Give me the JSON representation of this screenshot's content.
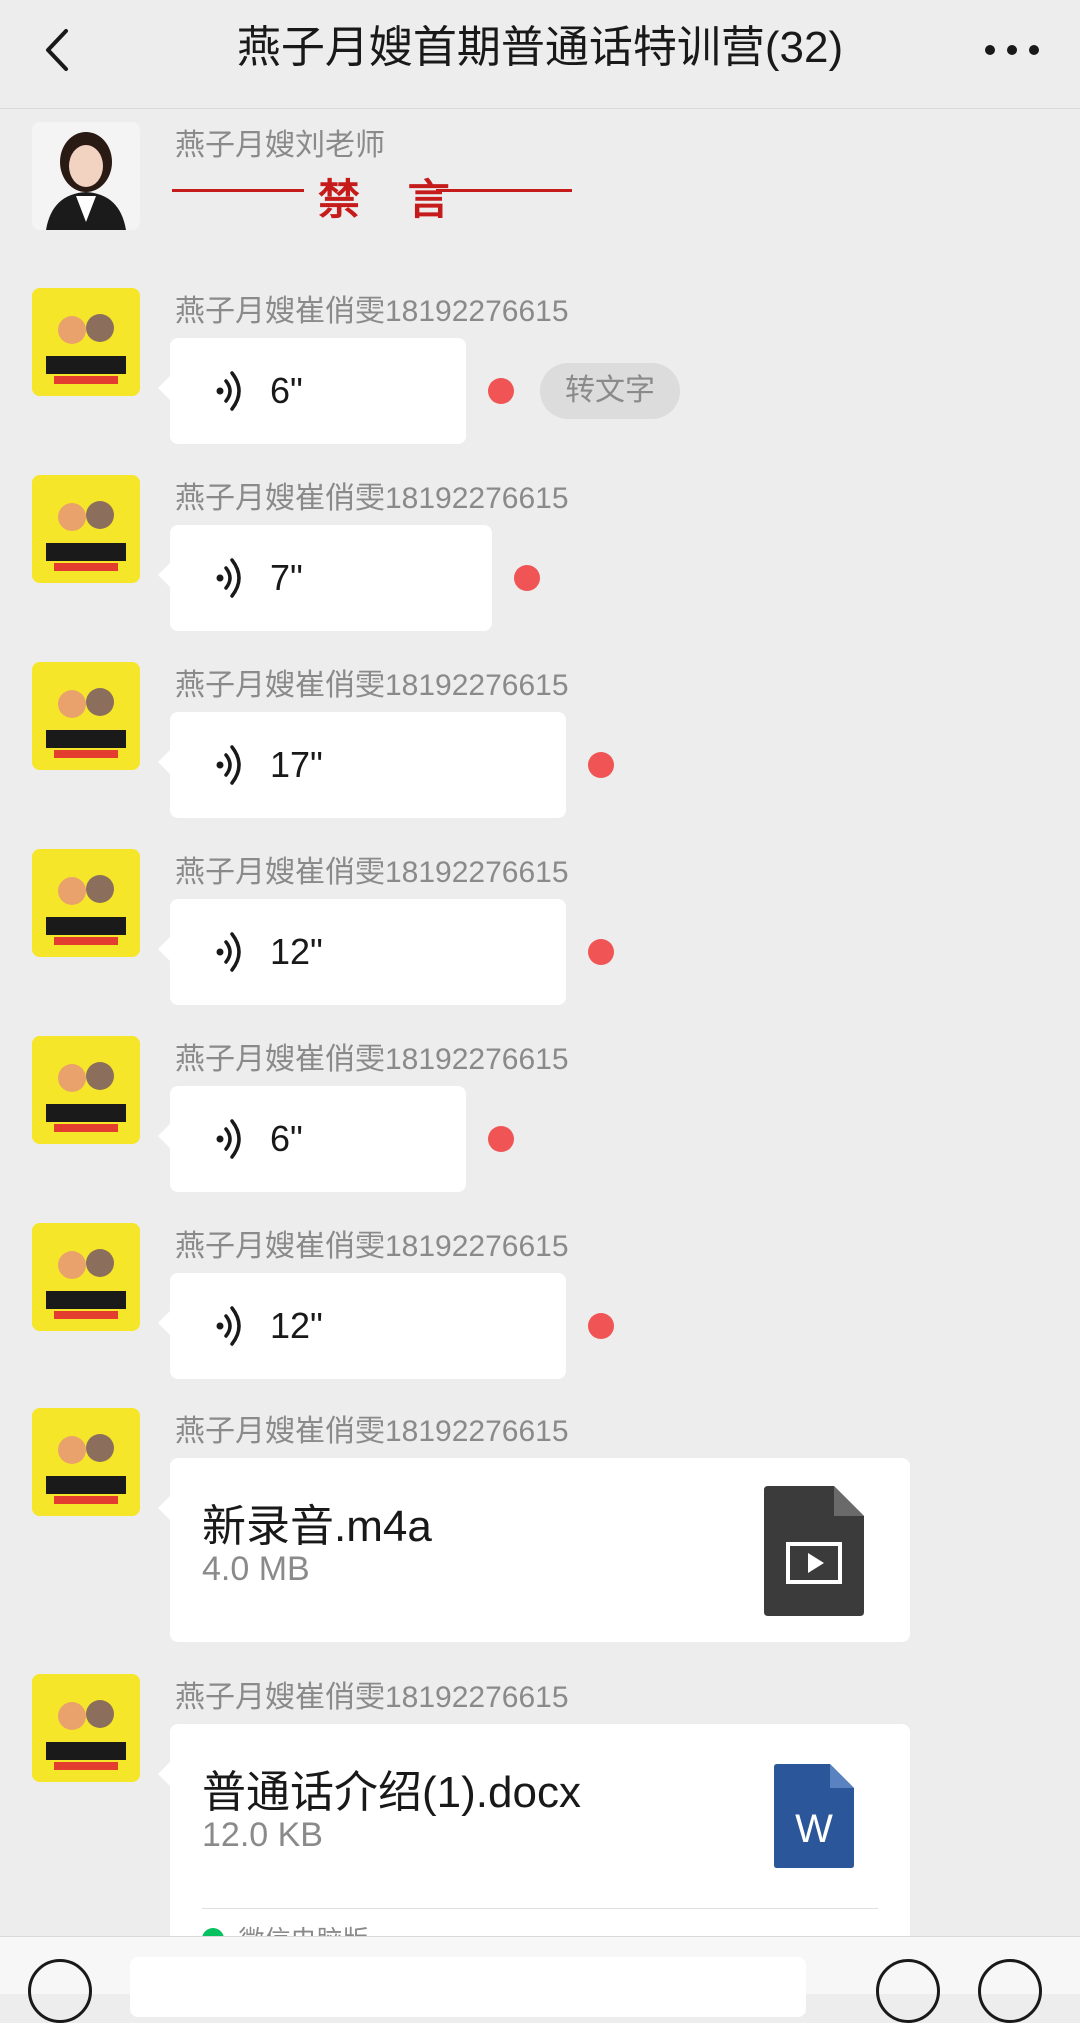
{
  "header": {
    "title": "燕子月嫂首期普通话特训营(32)"
  },
  "teacher_message": {
    "sender": "燕子月嫂刘老师",
    "status": "禁 言"
  },
  "voice_sender": "燕子月嫂崔俏雯18192276615",
  "voice_messages": [
    {
      "duration": "6\"",
      "unread": true,
      "transcribe_label": "转文字"
    },
    {
      "duration": "7\"",
      "unread": true
    },
    {
      "duration": "17\"",
      "unread": true
    },
    {
      "duration": "12\"",
      "unread": true
    },
    {
      "duration": "6\"",
      "unread": true
    },
    {
      "duration": "12\"",
      "unread": true
    }
  ],
  "file_messages": [
    {
      "sender": "燕子月嫂崔俏雯18192276615",
      "file_name": "新录音.m4a",
      "file_size": "4.0 MB",
      "icon": "video-file-icon"
    },
    {
      "sender": "燕子月嫂崔俏雯18192276615",
      "file_name": "普通话介绍(1).docx",
      "file_size": "12.0 KB",
      "icon": "word-file-icon",
      "icon_letter": "W",
      "footer_text": "微信电脑版"
    }
  ],
  "colors": {
    "background": "#ededed",
    "bubble": "#ffffff",
    "unread_dot": "#f05454",
    "mute_red": "#c51b1b",
    "brand_yellow": "#f6e62a",
    "word_blue": "#2b579a"
  }
}
